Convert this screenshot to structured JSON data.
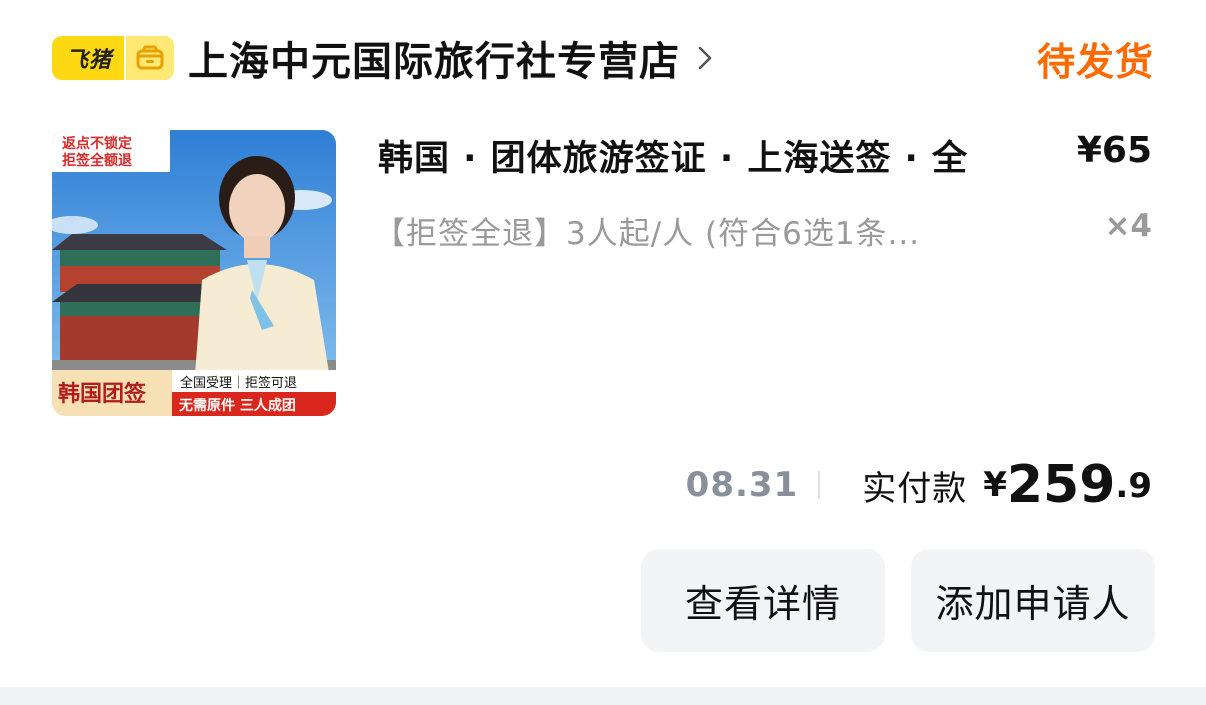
{
  "header": {
    "brand_text": "飞猪",
    "brand_icon": "shop-icon",
    "shop_name": "上海中元国际旅行社专营店",
    "status": "待发货"
  },
  "product": {
    "image": {
      "tag_top_line1": "返点不锁定",
      "tag_top_line2": "拒签全额退",
      "badge_main": "韩国团签",
      "badge_right_top": "全国受理｜拒签可退",
      "badge_right_bottom": "无需原件 三人成团"
    },
    "title": "韩国 · 团体旅游签证 · 上海送签 · 全",
    "price": "¥65",
    "subtitle": "【拒签全退】3人起/人 (符合6选1条...",
    "quantity": "×4"
  },
  "payment": {
    "date": "08.31",
    "label": "实付款",
    "symbol": "¥",
    "amount_int": "259",
    "amount_dec": ".9"
  },
  "actions": {
    "detail_label": "查看详情",
    "add_applicant_label": "添加申请人"
  },
  "colors": {
    "status": "#ff6a00",
    "brand": "#ffd814",
    "button_bg": "#f3f4f6",
    "muted_text": "#9a9a9a"
  }
}
